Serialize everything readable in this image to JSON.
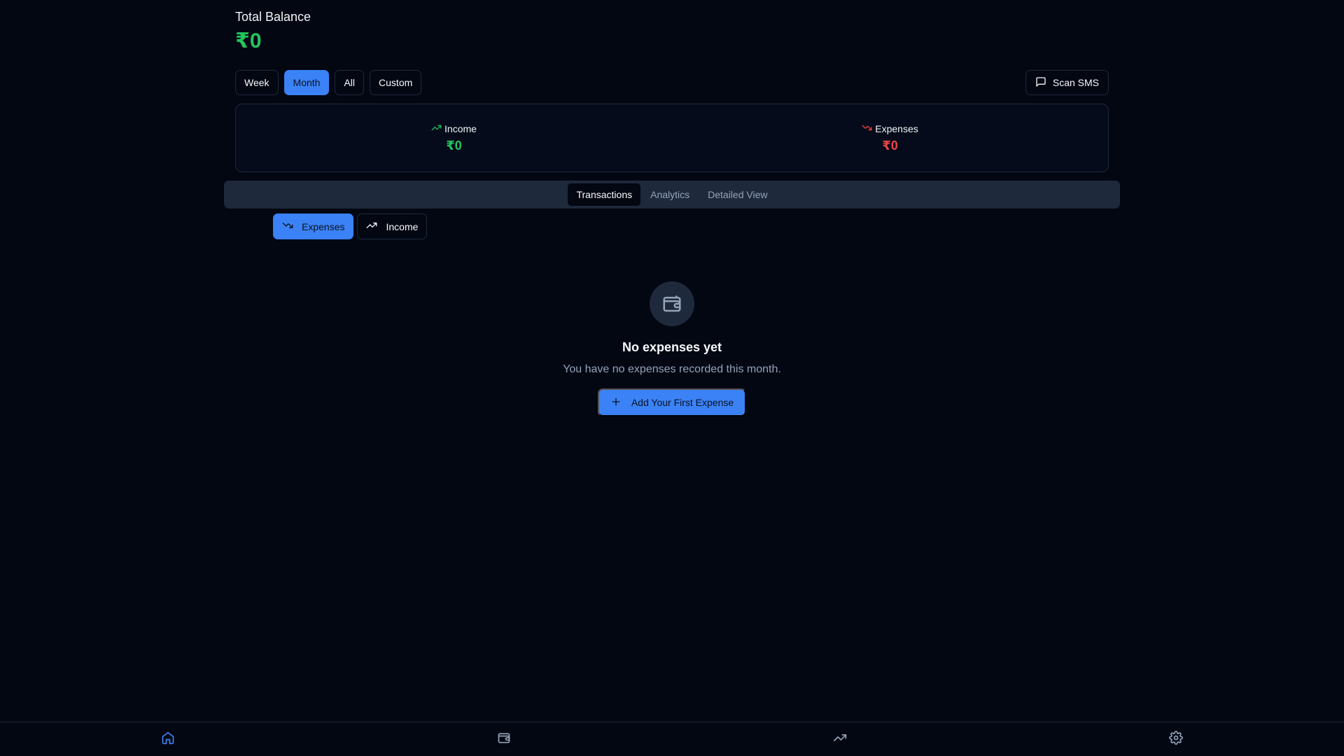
{
  "balance": {
    "label": "Total Balance",
    "amount": "₹0"
  },
  "period": {
    "options": [
      "Week",
      "Month",
      "All",
      "Custom"
    ],
    "selected": "Month"
  },
  "scan_sms": {
    "label": "Scan SMS",
    "icon": "message-square-icon"
  },
  "summary": {
    "income": {
      "label": "Income",
      "value": "₹0",
      "icon": "trending-up-icon",
      "color": "#22c55e"
    },
    "expenses": {
      "label": "Expenses",
      "value": "₹0",
      "icon": "trending-down-icon",
      "color": "#ef4444"
    }
  },
  "tabs": {
    "items": [
      "Transactions",
      "Analytics",
      "Detailed View"
    ],
    "selected": "Transactions"
  },
  "type_toggle": {
    "expenses": {
      "label": "Expenses",
      "icon": "trending-down-icon"
    },
    "income": {
      "label": "Income",
      "icon": "trending-up-icon"
    },
    "selected": "Expenses"
  },
  "empty_state": {
    "icon": "wallet-icon",
    "title": "No expenses yet",
    "subtitle": "You have no expenses recorded this month.",
    "button_label": "Add Your First Expense"
  },
  "bottom_nav": {
    "items": [
      "home-icon",
      "wallet-icon",
      "trending-up-icon",
      "settings-icon"
    ],
    "active": "home-icon"
  },
  "colors": {
    "accent": "#3b82f6",
    "income": "#22c55e",
    "expense": "#ef4444",
    "background": "#030712"
  }
}
